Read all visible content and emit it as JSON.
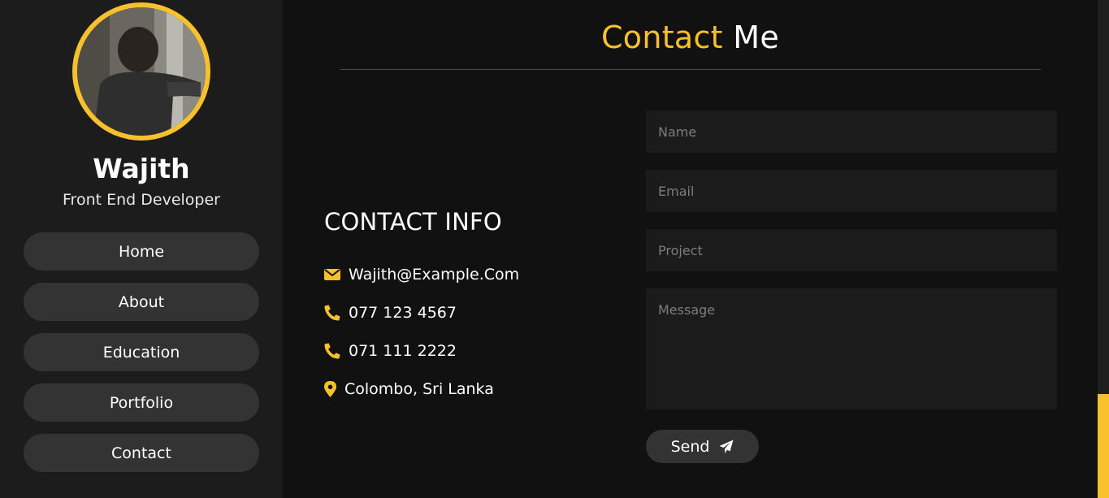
{
  "colors": {
    "accent": "#f8c12b",
    "background": "#111111",
    "sidebar": "#1c1c1c",
    "button": "#333333"
  },
  "profile": {
    "name": "Wajith",
    "role": "Front End Developer"
  },
  "nav": {
    "items": [
      {
        "label": "Home"
      },
      {
        "label": "About"
      },
      {
        "label": "Education"
      },
      {
        "label": "Portfolio"
      },
      {
        "label": "Contact"
      }
    ]
  },
  "page": {
    "title_accent": "Contact",
    "title_rest": "Me"
  },
  "contact_info": {
    "heading": "CONTACT INFO",
    "items": [
      {
        "icon": "envelope-icon",
        "text": "Wajith@Example.Com"
      },
      {
        "icon": "phone-icon",
        "text": "077 123 4567"
      },
      {
        "icon": "phone-icon",
        "text": "071 111 2222"
      },
      {
        "icon": "map-marker-icon",
        "text": "Colombo, Sri Lanka"
      }
    ]
  },
  "form": {
    "name_placeholder": "Name",
    "email_placeholder": "Email",
    "project_placeholder": "Project",
    "message_placeholder": "Message",
    "send_label": "Send",
    "send_icon": "paper-plane-icon"
  }
}
